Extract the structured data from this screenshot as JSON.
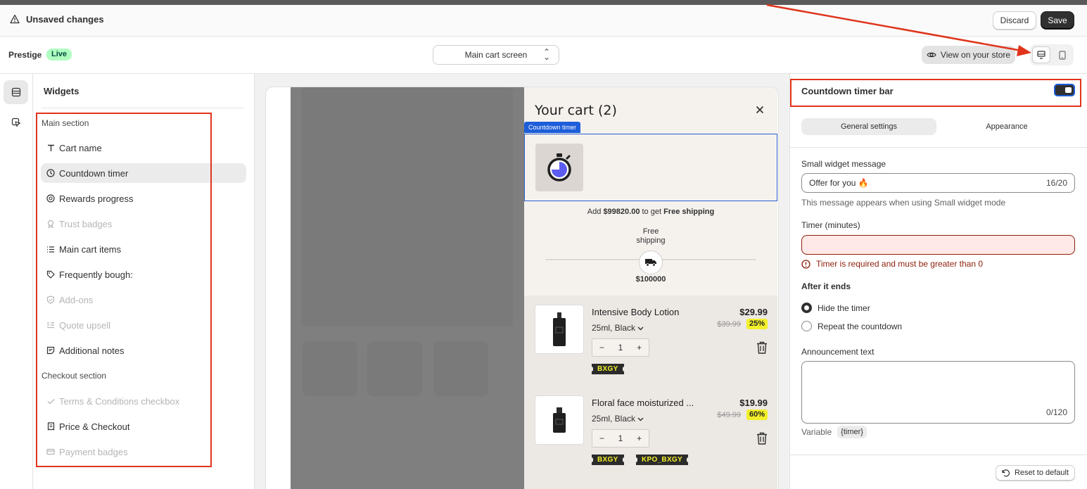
{
  "topbar": {
    "title": "Unsaved changes",
    "discard_label": "Discard",
    "save_label": "Save"
  },
  "header": {
    "theme_name": "Prestige",
    "live_badge": "Live",
    "screen_select_value": "Main cart screen",
    "view_store_label": "View on your store"
  },
  "widgets": {
    "title": "Widgets",
    "main_section_label": "Main section",
    "main_items": [
      {
        "label": "Cart name",
        "icon": "text-icon",
        "state": "enabled"
      },
      {
        "label": "Countdown timer",
        "icon": "clock-icon",
        "state": "selected"
      },
      {
        "label": "Rewards progress",
        "icon": "gift-icon",
        "state": "enabled"
      },
      {
        "label": "Trust badges",
        "icon": "badge-icon",
        "state": "disabled"
      },
      {
        "label": "Main cart items",
        "icon": "list-icon",
        "state": "enabled"
      },
      {
        "label": "Frequently bough:",
        "icon": "tag-icon",
        "state": "enabled"
      },
      {
        "label": "Add-ons",
        "icon": "shield-icon",
        "state": "disabled"
      },
      {
        "label": "Quote upsell",
        "icon": "quote-icon",
        "state": "disabled"
      },
      {
        "label": "Additional notes",
        "icon": "note-icon",
        "state": "enabled"
      }
    ],
    "checkout_section_label": "Checkout section",
    "checkout_items": [
      {
        "label": "Terms & Conditions checkbox",
        "icon": "check-icon",
        "state": "disabled"
      },
      {
        "label": "Price & Checkout",
        "icon": "receipt-icon",
        "state": "enabled"
      },
      {
        "label": "Payment badges",
        "icon": "card-icon",
        "state": "disabled"
      }
    ]
  },
  "cart": {
    "title": "Your cart (2)",
    "close_icon": "close-icon",
    "countdown_tag": "Countdown timer",
    "free_shipping_prefix": "Add ",
    "free_shipping_amount": "$99820.00",
    "free_shipping_mid": " to get ",
    "free_shipping_reward": "Free shipping",
    "progress_label_line1": "Free",
    "progress_label_line2": "shipping",
    "progress_goal": "$100000",
    "items": [
      {
        "name": "Intensive Body Lotion",
        "variant": "25ml, Black",
        "price": "$29.99",
        "old_price": "$39.99",
        "discount": "25%",
        "qty": "1",
        "coupons": [
          "BXGY"
        ]
      },
      {
        "name": "Floral face moisturized ...",
        "variant": "25ml, Black",
        "price": "$19.99",
        "old_price": "$49.99",
        "discount": "60%",
        "qty": "1",
        "coupons": [
          "BXGY",
          "KPO_BXGY"
        ]
      }
    ]
  },
  "settings": {
    "title": "Countdown timer bar",
    "toggle_on": true,
    "tab_general": "General settings",
    "tab_appearance": "Appearance",
    "small_msg_label": "Small widget message",
    "small_msg_value": "Offer for you 🔥",
    "small_msg_counter": "16/20",
    "small_msg_help": "This message appears when using Small widget mode",
    "timer_label": "Timer (minutes)",
    "timer_value": "",
    "timer_error": "Timer is required and must be greater than 0",
    "after_label": "After it ends",
    "option_hide": "Hide the timer",
    "option_repeat": "Repeat the countdown",
    "announcement_label": "Announcement text",
    "announcement_counter": "0/120",
    "variable_label": "Variable",
    "variable_chip": "{timer}",
    "reset_label": "Reset to default"
  },
  "colors": {
    "annotation_red": "#e0341c",
    "accent_blue": "#1d5dd9",
    "coupon_yellow": "#f3f02a",
    "live_green": "#affebf"
  }
}
